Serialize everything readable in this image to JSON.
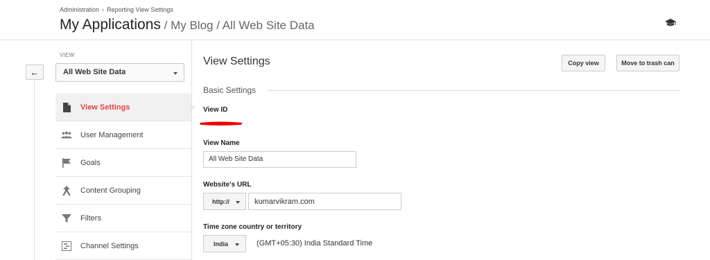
{
  "breadcrumb": {
    "admin": "Administration",
    "separator": "›",
    "current": "Reporting View Settings"
  },
  "title": {
    "main": "My Applications",
    "sub": " / My Blog / All Web Site Data"
  },
  "header_icon": "graduation-cap-icon",
  "sidebar": {
    "view_label": "VIEW",
    "view_select": "All Web Site Data",
    "items": [
      {
        "label": "View Settings",
        "icon": "document-icon",
        "active": true
      },
      {
        "label": "User Management",
        "icon": "users-icon"
      },
      {
        "label": "Goals",
        "icon": "flag-icon"
      },
      {
        "label": "Content Grouping",
        "icon": "grouping-icon"
      },
      {
        "label": "Filters",
        "icon": "filter-icon"
      },
      {
        "label": "Channel Settings",
        "icon": "channel-settings-icon"
      }
    ]
  },
  "main": {
    "heading": "View Settings",
    "copy_button": "Copy view",
    "trash_button": "Move to trash can",
    "section": "Basic Settings",
    "view_id_label": "View ID",
    "view_name_label": "View Name",
    "view_name_value": "All Web Site Data",
    "url_label": "Website's URL",
    "url_protocol": "http://",
    "url_value": "kumarvikram.com",
    "timezone_label": "Time zone country or territory",
    "timezone_country": "India",
    "timezone_value": "(GMT+05:30) India Standard Time"
  },
  "colors": {
    "active_text": "#dd4444",
    "redaction": "#ee0000"
  }
}
